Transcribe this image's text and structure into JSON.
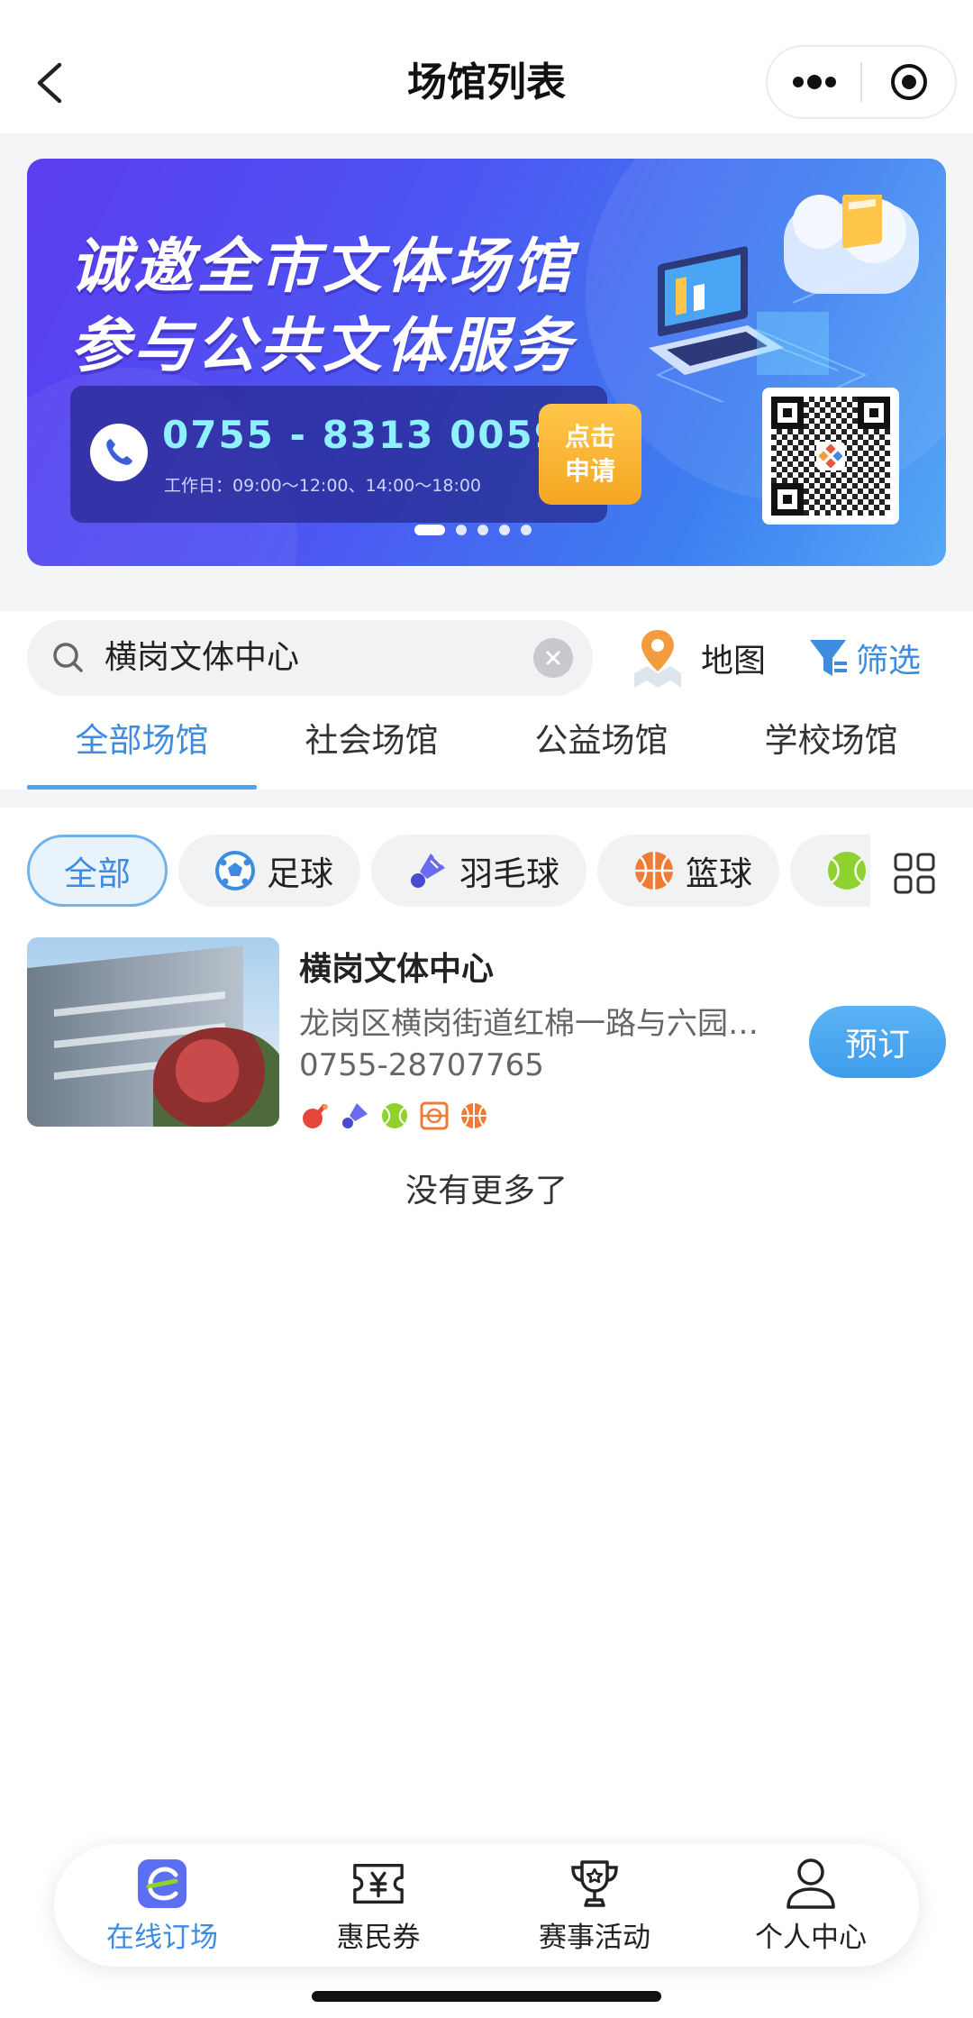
{
  "nav": {
    "title": "场馆列表",
    "back_icon": "chevron-left-icon",
    "more_icon": "more-dots-icon",
    "close_icon": "target-circle-icon"
  },
  "banner": {
    "line1": "诚邀全市文体场馆",
    "line2": "参与公共文体服务",
    "phone": "0755 - 8313 0059",
    "hours": "工作日：09:00～12:00、14:00～18:00",
    "apply_line1": "点击",
    "apply_line2": "申请",
    "dots_total": 5,
    "dots_active": 1
  },
  "search": {
    "value": "横岗文体中心",
    "map_label": "地图",
    "filter_label": "筛选"
  },
  "tabs": [
    {
      "label": "全部场馆",
      "active": true
    },
    {
      "label": "社会场馆",
      "active": false
    },
    {
      "label": "公益场馆",
      "active": false
    },
    {
      "label": "学校场馆",
      "active": false
    }
  ],
  "chips": [
    {
      "label": "全部",
      "icon": "",
      "active": true
    },
    {
      "label": "足球",
      "icon": "football-icon",
      "active": false
    },
    {
      "label": "羽毛球",
      "icon": "shuttlecock-icon",
      "active": false
    },
    {
      "label": "篮球",
      "icon": "basketball-icon",
      "active": false
    },
    {
      "label": "",
      "icon": "tennis-ball-icon",
      "active": false
    }
  ],
  "venue": {
    "name": "横岗文体中心",
    "address": "龙岗区横岗街道红棉一路与六园…",
    "phone": "0755-28707765",
    "sports": [
      "table-tennis-icon",
      "shuttlecock-icon",
      "tennis-ball-icon",
      "basketball-court-icon",
      "basketball-icon"
    ],
    "book_label": "预订"
  },
  "list_end": "没有更多了",
  "tabbar": [
    {
      "label": "在线订场",
      "icon": "online-booking-icon",
      "active": true
    },
    {
      "label": "惠民券",
      "icon": "coupon-icon",
      "active": false
    },
    {
      "label": "赛事活动",
      "icon": "trophy-icon",
      "active": false
    },
    {
      "label": "个人中心",
      "icon": "person-icon",
      "active": false
    }
  ],
  "colors": {
    "accent": "#3d8ce0",
    "banner_start": "#5b3df0",
    "banner_end": "#55a8f7",
    "phone_text": "#8ff0ff",
    "apply_button": "#f5a623"
  }
}
